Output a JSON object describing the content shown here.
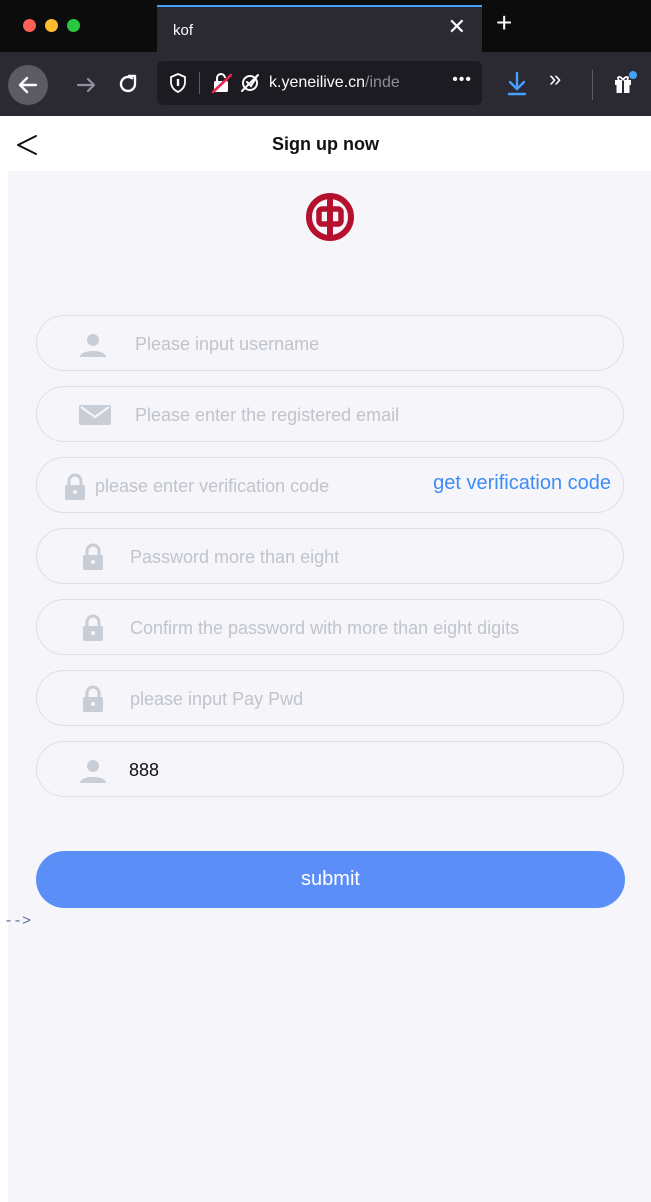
{
  "browser": {
    "tab_title": "kof",
    "url_host": "k.yeneilive.cn",
    "url_path": "/inde",
    "url_more": "•••",
    "overflow_glyph": "»"
  },
  "header": {
    "title": "Sign up now"
  },
  "form": {
    "username": {
      "placeholder": "Please input username",
      "icon": "person-icon"
    },
    "email": {
      "placeholder": "Please enter the registered email",
      "icon": "mail-icon"
    },
    "code": {
      "placeholder": "please enter verification code",
      "button": "get verification code",
      "icon": "lock-icon"
    },
    "password": {
      "placeholder": "Password more than eight",
      "icon": "lock-icon"
    },
    "confirm": {
      "placeholder": "Confirm the password with more than eight digits",
      "icon": "lock-icon"
    },
    "paypwd": {
      "placeholder": "please input Pay Pwd",
      "icon": "lock-icon"
    },
    "invite": {
      "value": "888",
      "icon": "person-icon"
    },
    "submit_label": "submit"
  },
  "stray_text": "-->",
  "colors": {
    "accent": "#5b8ff7",
    "link": "#3f8cf4",
    "logo": "#b5112e",
    "background": "#f5f5fa"
  }
}
